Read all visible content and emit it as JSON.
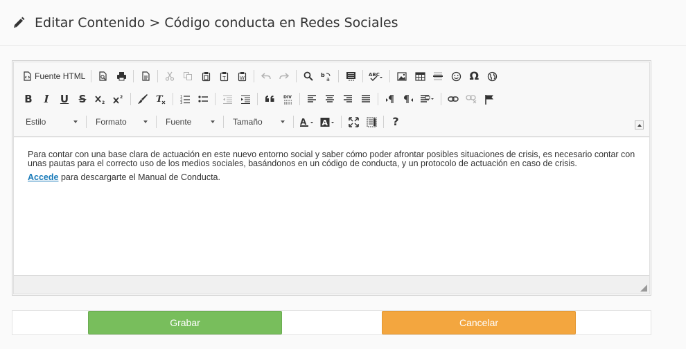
{
  "header": {
    "title": "Editar Contenido > Código conducta en Redes Sociales",
    "icon": "pencil-icon"
  },
  "toolbar": {
    "source_label": "Fuente HTML",
    "combos": {
      "style": "Estilo",
      "format": "Formato",
      "font": "Fuente",
      "size": "Tamaño"
    },
    "help_label": "?",
    "subscript_label": "x",
    "superscript_label": "x",
    "blockquote_label": "99",
    "creatediv_label": "DIV"
  },
  "content": {
    "paragraph1": "Para contar con una base clara de actuación en este nuevo entorno social y saber cómo poder afrontar posibles situaciones de crisis, es necesario contar con unas pautas para el correcto uso de los medios sociales, basándonos en un código de conducta, y un protocolo de actuación en caso de crisis.",
    "link_text": "Accede",
    "paragraph2_rest": " para descargarte el Manual de Conducta."
  },
  "actions": {
    "save_label": "Grabar",
    "cancel_label": "Cancelar"
  },
  "colors": {
    "save": "#78be5c",
    "cancel": "#f3a63f",
    "link": "#1a7bb9"
  }
}
